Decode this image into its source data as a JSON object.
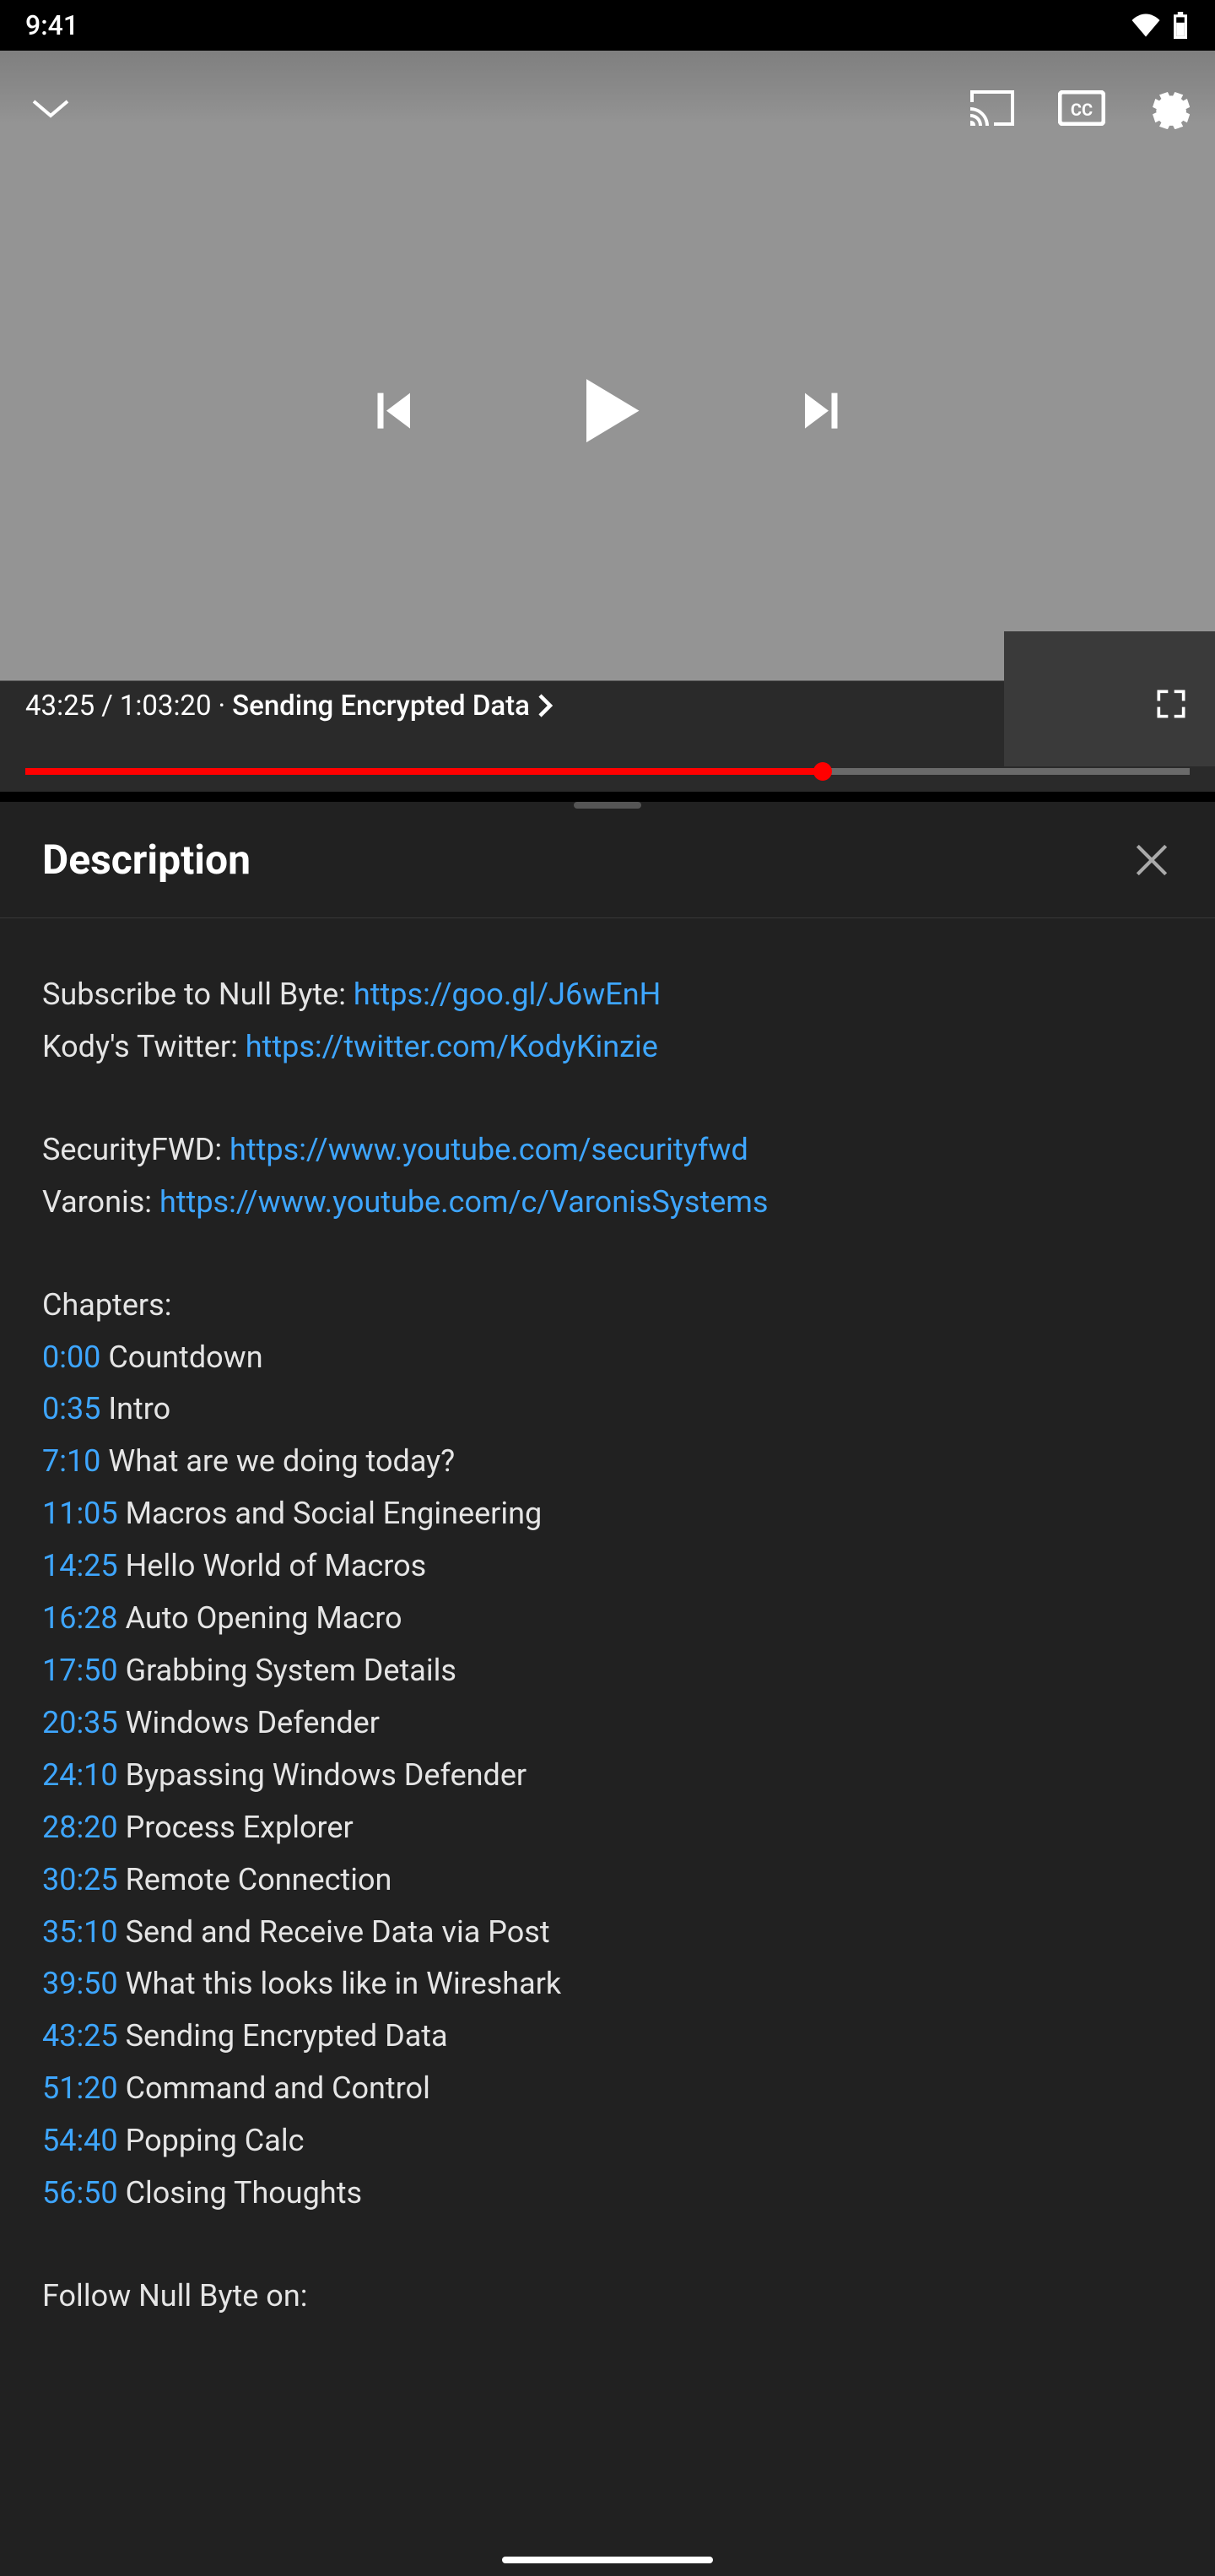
{
  "statusBar": {
    "time": "9:41"
  },
  "video": {
    "currentTime": "43:25",
    "duration": "1:03:20",
    "separator": "/",
    "chapterSeparator": "·",
    "currentChapter": "Sending Encrypted Data"
  },
  "panel": {
    "title": "Description"
  },
  "description": {
    "subscribeLabel": "Subscribe to Null Byte: ",
    "subscribeUrl": "https://goo.gl/J6wEnH",
    "twitterLabel": "Kody's Twitter: ",
    "twitterUrl": "https://twitter.com/KodyKinzie",
    "securityLabel": "SecurityFWD: ",
    "securityUrl": "https://www.youtube.com/securityfwd",
    "varonisLabel": "Varonis: ",
    "varonisUrl": "https://www.youtube.com/c/VaronisSystems",
    "chaptersHeading": "Chapters:",
    "chapters": [
      {
        "time": "0:00",
        "title": " Countdown"
      },
      {
        "time": "0:35",
        "title": " Intro"
      },
      {
        "time": "7:10",
        "title": " What are we doing today?"
      },
      {
        "time": "11:05",
        "title": " Macros and Social Engineering"
      },
      {
        "time": "14:25",
        "title": " Hello World of Macros"
      },
      {
        "time": "16:28",
        "title": " Auto Opening Macro"
      },
      {
        "time": "17:50",
        "title": " Grabbing System Details"
      },
      {
        "time": "20:35",
        "title": " Windows Defender"
      },
      {
        "time": "24:10",
        "title": " Bypassing Windows Defender"
      },
      {
        "time": "28:20",
        "title": " Process Explorer"
      },
      {
        "time": "30:25",
        "title": " Remote Connection"
      },
      {
        "time": "35:10",
        "title": " Send and Receive Data via Post"
      },
      {
        "time": "39:50",
        "title": " What this looks like in Wireshark"
      },
      {
        "time": "43:25",
        "title": " Sending Encrypted Data"
      },
      {
        "time": "51:20",
        "title": " Command and Control"
      },
      {
        "time": "54:40",
        "title": " Popping Calc"
      },
      {
        "time": "56:50",
        "title": " Closing Thoughts"
      }
    ],
    "followLabel": "Follow Null Byte on:"
  }
}
